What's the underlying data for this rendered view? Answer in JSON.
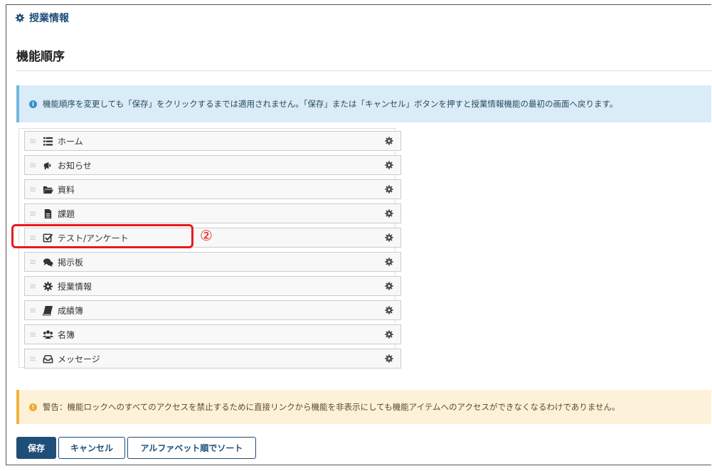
{
  "header": {
    "section_title": "授業情報"
  },
  "page": {
    "title": "機能順序"
  },
  "info": {
    "text": "機能順序を変更しても「保存」をクリックするまでは適用されません。「保存」または「キャンセル」ボタンを押すと授業情報機能の最初の画面へ戻ります。"
  },
  "tools": [
    {
      "label": "ホーム",
      "icon": "list-icon"
    },
    {
      "label": "お知らせ",
      "icon": "megaphone-icon"
    },
    {
      "label": "資料",
      "icon": "folder-open-icon"
    },
    {
      "label": "課題",
      "icon": "file-icon"
    },
    {
      "label": "テスト/アンケート",
      "icon": "check-square-icon"
    },
    {
      "label": "掲示板",
      "icon": "comments-icon"
    },
    {
      "label": "授業情報",
      "icon": "gear-icon"
    },
    {
      "label": "成績簿",
      "icon": "book-icon"
    },
    {
      "label": "名簿",
      "icon": "users-icon"
    },
    {
      "label": "メッセージ",
      "icon": "inbox-icon"
    }
  ],
  "annotation": {
    "marker": "②",
    "color": "#e8191e"
  },
  "warning": {
    "text": "警告：機能ロックへのすべてのアクセスを禁止するために直接リンクから機能を非表示にしても機能アイテムへのアクセスができなくなるわけでありません。"
  },
  "buttons": {
    "save": "保存",
    "cancel": "キャンセル",
    "sort": "アルファベット順でソート"
  },
  "colors": {
    "primary": "#1f4e79",
    "info_bg": "#d9ecf7",
    "warn_bg": "#fdf2d9"
  }
}
